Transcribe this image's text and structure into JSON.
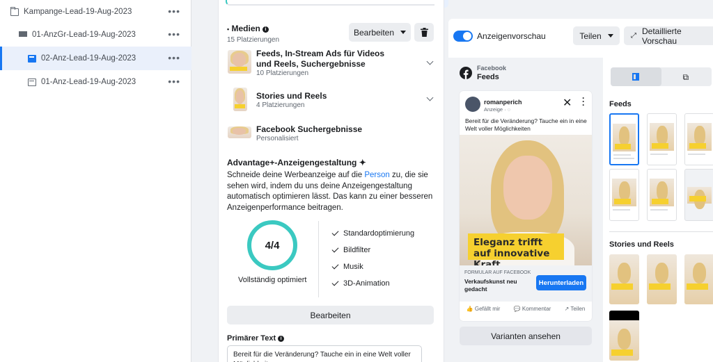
{
  "tree": {
    "items": [
      {
        "label": "Kampange-Lead-19-Aug-2023",
        "icon": "folder-icon"
      },
      {
        "label": "01-AnzGr-Lead-19-Aug-2023",
        "icon": "adset-grid-icon"
      },
      {
        "label": "02-Anz-Lead-19-Aug-2023",
        "icon": "ad-icon",
        "selected": true
      },
      {
        "label": "01-Anz-Lead-19-Aug-2023",
        "icon": "ad-icon"
      }
    ],
    "more": "•••"
  },
  "colors": {
    "accent": "#1877f2",
    "ring": "#3bc9c1",
    "banner": "#f6d02f"
  },
  "media": {
    "title": "Medien",
    "count": "15 Platzierungen",
    "edit_label": "Bearbeiten",
    "groups": [
      {
        "title": "Feeds, In-Stream Ads für Videos und Reels, Suchergebnisse",
        "sub": "10 Platzierungen"
      },
      {
        "title": "Stories und Reels",
        "sub": "4 Platzierungen"
      },
      {
        "title": "Facebook Suchergebnisse",
        "sub": "Personalisiert"
      }
    ]
  },
  "advantage": {
    "title": "Advantage+-Anzeigengestaltung",
    "desc_before": "Schneide deine Werbeanzeige auf die ",
    "desc_link": "Person",
    "desc_after": " zu, die sie sehen wird, indem du uns deine Anzeigengestaltung automatisch optimieren lässt. Das kann zu einer besseren Anzeigenperformance beitragen.",
    "score": "4/4",
    "score_label": "Vollständig optimiert",
    "features": [
      "Standardoptimierung",
      "Bildfilter",
      "Musik",
      "3D-Animation"
    ],
    "edit_label": "Bearbeiten"
  },
  "primary_text": {
    "label": "Primärer Text",
    "value": "Bereit für die Veränderung? Tauche ein in eine Welt voller Möglichkeiten"
  },
  "preview": {
    "toggle_label": "Anzeigenvorschau",
    "share_label": "Teilen",
    "detail_label": "Detaillierte Vorschau",
    "platform": "Facebook",
    "placement": "Feeds",
    "variants_label": "Varianten ansehen",
    "post": {
      "account": "romanperich",
      "sponsored": "Anzeige ·",
      "text": "Bereit für die Veränderung? Tauche ein in eine Welt voller Möglichkeiten",
      "banner": "Eleganz trifft auf innovative Kraft",
      "form_label": "FORMULAR AUF FACEBOOK",
      "headline": "Verkaufskunst neu gedacht",
      "cta": "Herunterladen",
      "actions": [
        "Gefällt mir",
        "Kommentar",
        "Teilen"
      ]
    },
    "side": {
      "feeds_label": "Feeds",
      "stories_label": "Stories und Reels"
    }
  }
}
